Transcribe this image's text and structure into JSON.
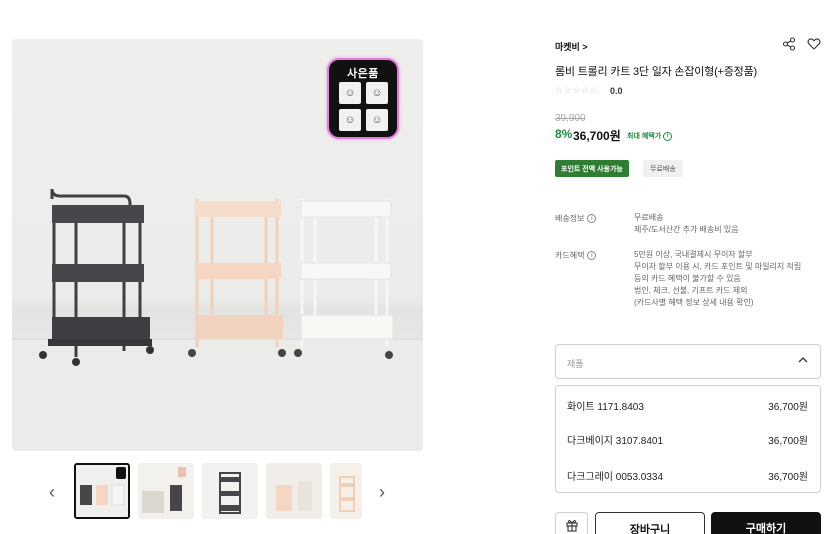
{
  "gallery": {
    "gift_badge": "사은품",
    "thumbnail_count": 5,
    "prev_icon": "chevron-left-icon",
    "next_icon": "chevron-right-icon"
  },
  "product": {
    "seller": "마켓비 >",
    "title": "롬비 트롤리 카트 3단 일자 손잡이형(+증정품)",
    "stars": "☆☆☆☆☆",
    "rating": "0.0",
    "original_price": "39,900",
    "discount": "8%",
    "price": "36,700원",
    "max_benefit": "최대 혜택가",
    "badges": {
      "point": "포인트 전액 사용가능",
      "shipping": "무료배송"
    }
  },
  "shipping_info": {
    "label": "배송정보",
    "lines": [
      "무료배송",
      "제주/도서산간 추가 배송비 있음"
    ]
  },
  "card_benefit": {
    "label": "카드혜택",
    "lines": [
      "5만원 이상, 국내결제시 무이자 할부",
      "무이자 할부 이용 시, 카드 포인트 및 마일리지 적립",
      "등의 카드 혜택이 불가할 수 있음",
      "법인, 체크, 선불, 기프트 카드 제외",
      "(카드사별 혜택 정보 상세 내용 확인)"
    ]
  },
  "options": {
    "placeholder": "제품",
    "items": [
      {
        "name": "화이트 1171.8403",
        "price": "36,700원"
      },
      {
        "name": "다크베이지 3107.8401",
        "price": "36,700원"
      },
      {
        "name": "다크그레이 0053.0334",
        "price": "36,700원"
      }
    ]
  },
  "actions": {
    "cart": "장바구니",
    "buy": "구매하기"
  },
  "colors": {
    "accent_green": "#1f8a3b",
    "badge_green": "#2f7d32",
    "buy_button": "#111111"
  }
}
